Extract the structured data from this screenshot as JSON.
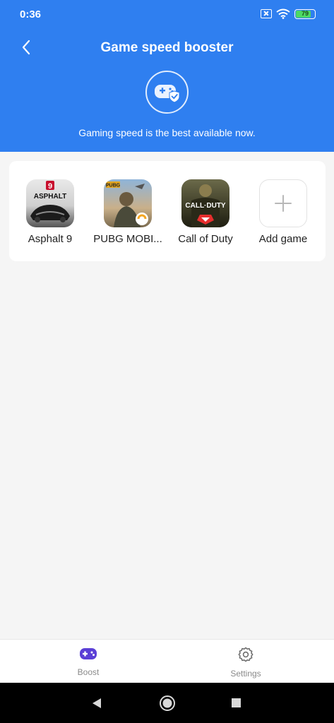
{
  "status_bar": {
    "time": "0:36",
    "battery": "79"
  },
  "header": {
    "title": "Game speed booster",
    "subtitle": "Gaming speed is the best available now."
  },
  "games": [
    {
      "label": "Asphalt 9",
      "icon": "asphalt-9-app-icon",
      "badge_text": "ASPHALT",
      "badge_number": "9"
    },
    {
      "label": "PUBG MOBI...",
      "icon": "pubg-mobile-app-icon",
      "badge_text": "PUBG"
    },
    {
      "label": "Call of Duty",
      "icon": "call-of-duty-app-icon",
      "badge_text": "CALL·DUTY"
    },
    {
      "label": "Add game",
      "icon": "plus-icon"
    }
  ],
  "bottom_nav": {
    "boost": {
      "label": "Boost",
      "icon": "gamepad-icon",
      "active_color": "#5b3fd6"
    },
    "settings": {
      "label": "Settings",
      "icon": "gear-icon"
    }
  },
  "colors": {
    "header": "#2f7ff0",
    "background": "#f5f5f5"
  }
}
